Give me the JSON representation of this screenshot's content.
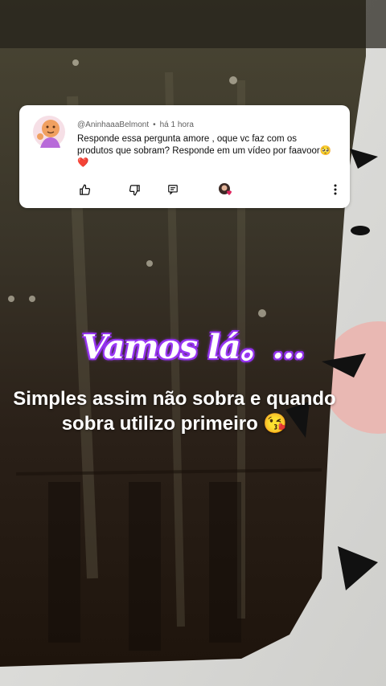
{
  "comment": {
    "username": "@AninhaaaBelmont",
    "separator": "•",
    "time": "há 1 hora",
    "text": "Responde essa pergunta amore , oque vc faz com os produtos que sobram? Responde em um vídeo por faavoor🥺❤️",
    "actions": {
      "like_icon": "thumbs-up-icon",
      "dislike_icon": "thumbs-down-icon",
      "reply_icon": "reply-icon",
      "creator_heart_icon": "creator-heart-icon",
      "more_icon": "more-vertical-icon"
    }
  },
  "overlay": {
    "title": "Vamos lá。...",
    "caption": "Simples assim não sobra e quando sobra utilizo primeiro 😘"
  },
  "colors": {
    "title_glow": "#8a2be2",
    "heart": "#e0245e",
    "card_bg": "#ffffff"
  }
}
